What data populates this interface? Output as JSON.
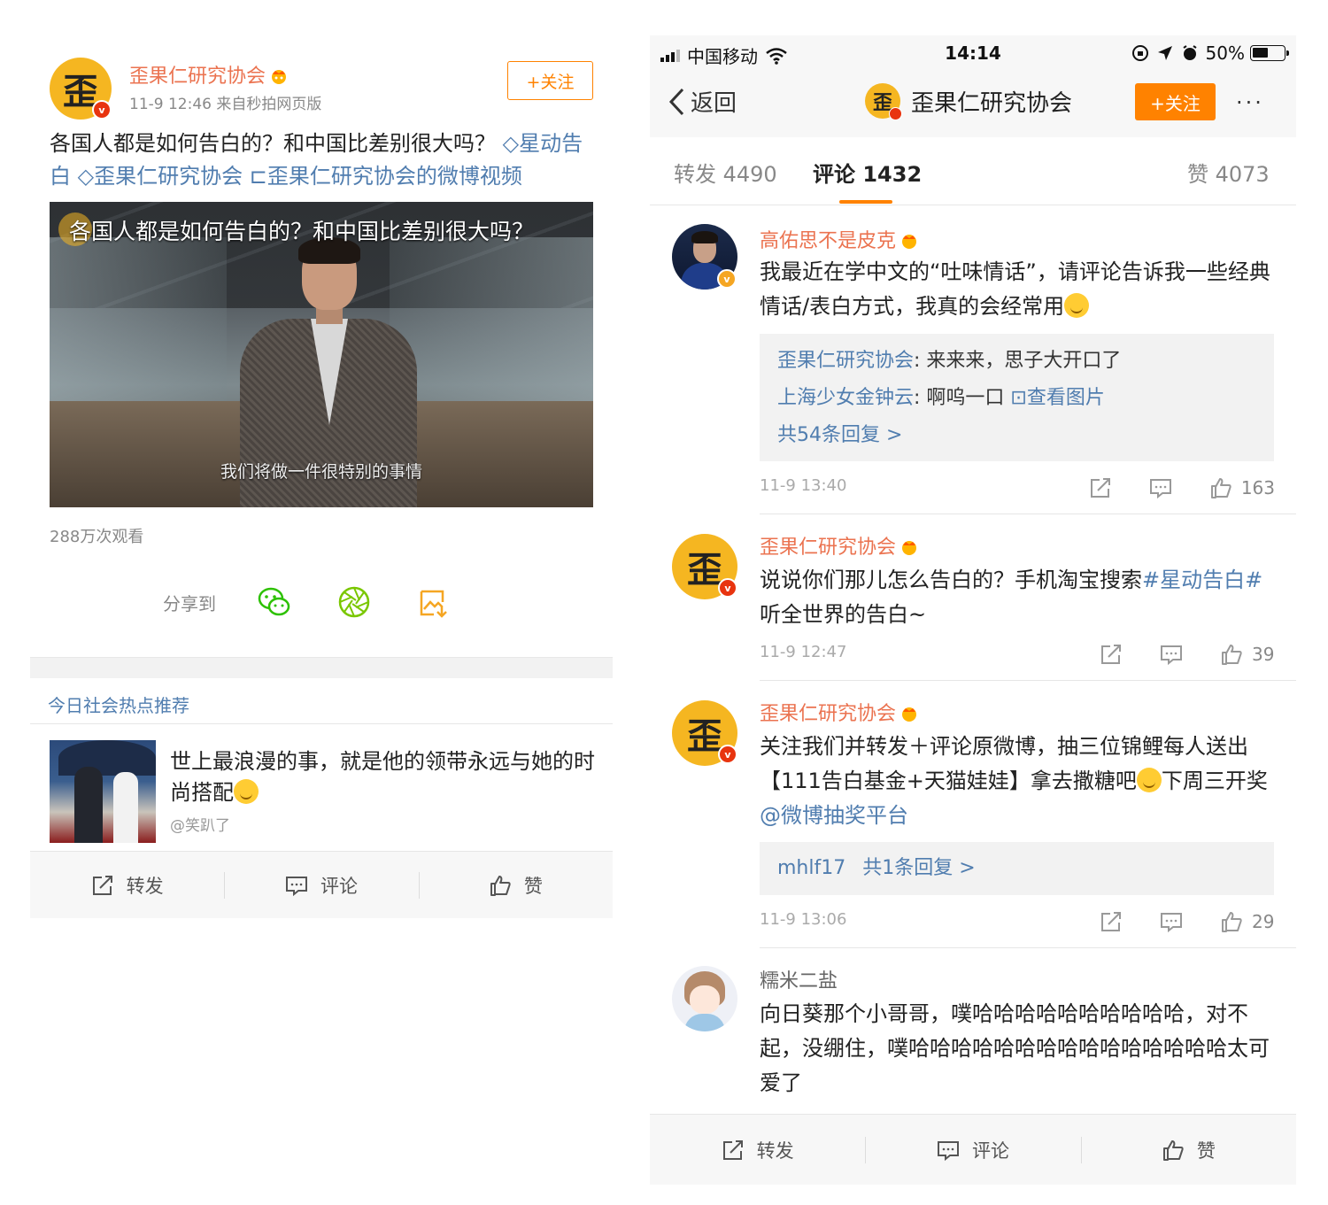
{
  "left_post": {
    "author": "歪果仁研究协会",
    "avatar_char": "歪",
    "verified_badge": "v",
    "meta": "11-9 12:46  来自秒拍网页版",
    "follow_label": "+关注",
    "text_main": "各国人都是如何告白的？和中国比差别很大吗？",
    "topic_link": "◇星动告白",
    "mention_link": "◇歪果仁研究协会",
    "video_link": "⊏歪果仁研究协会的微博视频",
    "video": {
      "title_overlay": "各国人都是如何告白的？和中国比差别很大吗？",
      "subtitle": "我们将做一件很特别的事情"
    },
    "views": "288万次观看",
    "share_label": "分享到",
    "share_icons": [
      "wechat-icon",
      "moments-icon",
      "save-image-icon"
    ]
  },
  "hot": {
    "section_title": "今日社会热点推荐",
    "text": "世上最浪漫的事，就是他的领带永远与她的时尚搭配",
    "source": "@笑趴了"
  },
  "left_actions": {
    "repost": "转发",
    "comment": "评论",
    "like": "赞"
  },
  "status_bar": {
    "carrier": "中国移动",
    "time": "14:14",
    "battery": "50%"
  },
  "nav": {
    "back_label": "返回",
    "title": "歪果仁研究协会",
    "avatar_char": "歪",
    "follow_label": "+关注",
    "more_label": "···"
  },
  "tabs": {
    "repost": "转发 4490",
    "comments": "评论 1432",
    "likes": "赞 4073"
  },
  "comments": [
    {
      "name": "高佑思不是皮克",
      "text": "我最近在学中文的“吐味情话”，请评论告诉我一些经典情话/表白方式，我真的会经常用",
      "replies": [
        {
          "name": "歪果仁研究协会",
          "text": ": 来来来，思子大开口了"
        },
        {
          "name": "上海少女金钟云",
          "text": ": 啊呜一口 ",
          "link": "⊡查看图片"
        }
      ],
      "reply_count": "共54条回复 >",
      "time": "11-9 13:40",
      "likes": "163"
    },
    {
      "name": "歪果仁研究协会",
      "avatar_char": "歪",
      "text_pre": "说说你们那儿怎么告白的？手机淘宝搜索",
      "text_link": "#星动告白#",
      "text_post": "听全世界的告白~",
      "time": "11-9 12:47",
      "likes": "39"
    },
    {
      "name": "歪果仁研究协会",
      "avatar_char": "歪",
      "text_pre": "关注我们并转发＋评论原微博，抽三位锦鲤每人送出【111告白基金+天猫娃娃】拿去撒糖吧",
      "text_mid": "下周三开奖",
      "text_link": "@微博抽奖平台",
      "reply_name": "mhlf17",
      "reply_count": "共1条回复 >",
      "time": "11-9 13:06",
      "likes": "29"
    },
    {
      "name": "糯米二盐",
      "text": "向日葵那个小哥哥，噗哈哈哈哈哈哈哈哈哈哈，对不起，没绷住，噗哈哈哈哈哈哈哈哈哈哈哈哈哈哈哈太可爱了"
    }
  ],
  "right_actions": {
    "repost": "转发",
    "comment": "评论",
    "like": "赞"
  },
  "colors": {
    "accent": "#ff8200",
    "name_orange": "#eb7350",
    "link_blue": "#507daf",
    "brand_yellow": "#f5b621"
  }
}
